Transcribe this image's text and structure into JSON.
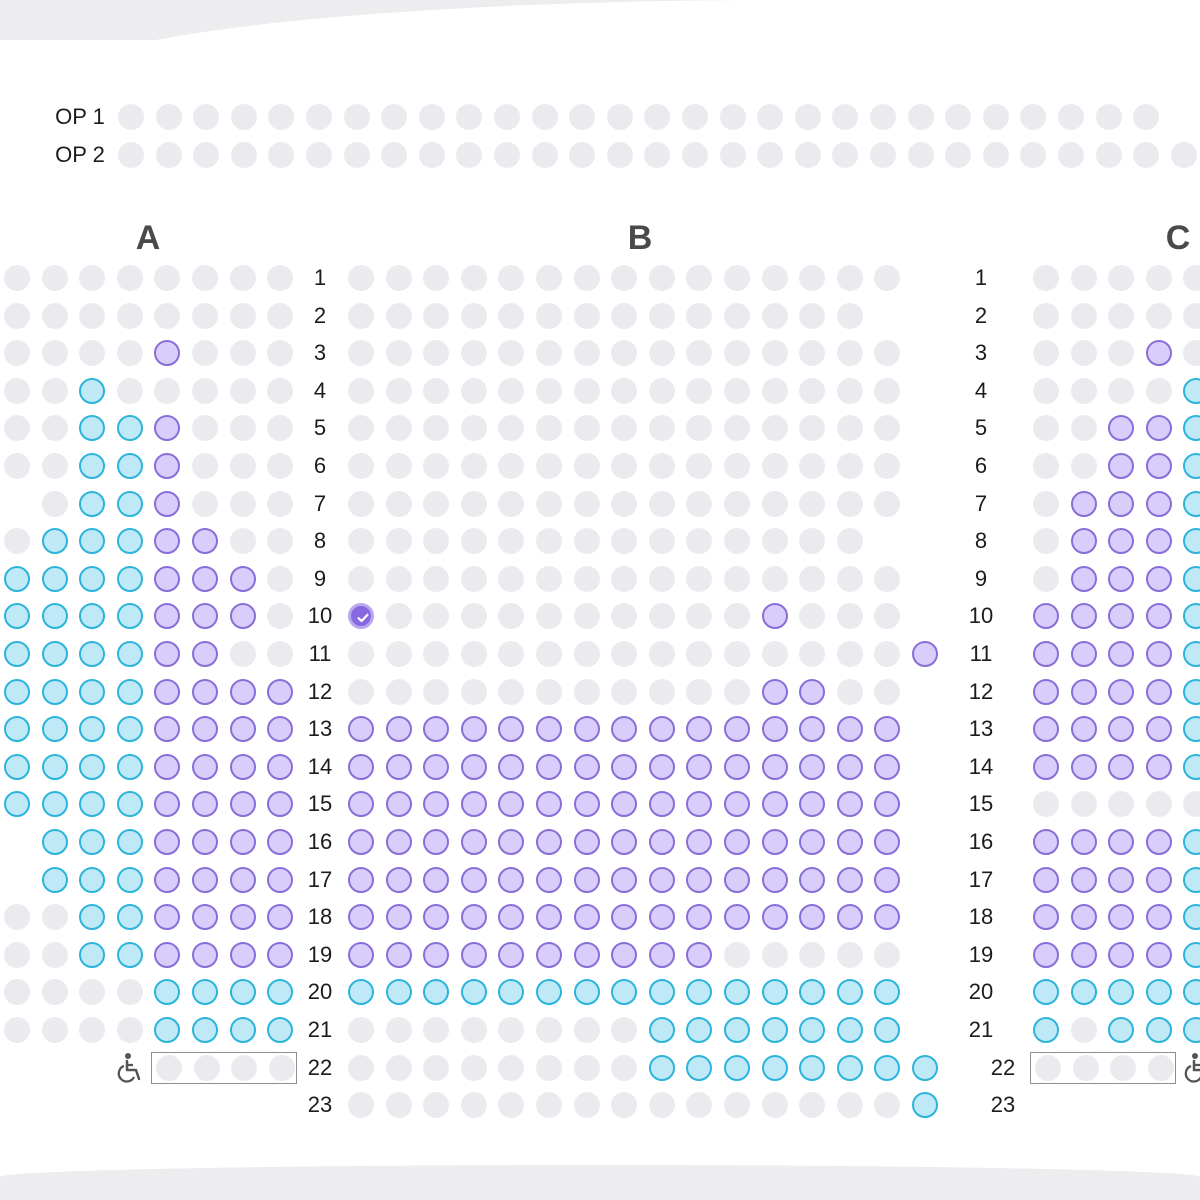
{
  "sections": {
    "a": "A",
    "b": "B",
    "c": "C"
  },
  "op_rows": [
    "OP 1",
    "OP 2"
  ],
  "rows_a": [
    "1",
    "2",
    "3",
    "4",
    "5",
    "6",
    "7",
    "8",
    "9",
    "10",
    "11",
    "12",
    "13",
    "14",
    "15",
    "16",
    "17",
    "18",
    "19",
    "20",
    "21",
    "22",
    "23"
  ],
  "rows_b_right": [
    "1",
    "2",
    "3",
    "4",
    "5",
    "6",
    "7",
    "8",
    "9",
    "10",
    "11",
    "12",
    "13",
    "14",
    "15",
    "16",
    "17",
    "18",
    "19",
    "20",
    "21",
    "22",
    "23"
  ],
  "legend": {
    "unavailable": "unavailable-seat",
    "blue": "blue-category-seat",
    "purple": "purple-category-seat",
    "selected": "selected-seat"
  },
  "colors": {
    "unavailable": "#ebebef",
    "blue_fill": "#bfe9f7",
    "blue_border": "#2cb4db",
    "purple_fill": "#d9cdfb",
    "purple_border": "#8a6ed8",
    "selected": "#8668e0"
  },
  "icons": {
    "wheelchair": "wheelchair-icon",
    "check": "check-icon"
  },
  "seatmap": {
    "A": [
      "uuuuuuuu",
      "uuuuuuuu",
      "uuuupuuu",
      "uubuuuuu",
      "uubbpuuu",
      "uubbpuuu",
      "-ubbpuuu",
      "ubbbppuu",
      "bbbbpppu",
      "bbbbpppu",
      "bbbbppuu",
      "bbbbpppp",
      "bbbbpppp",
      "bbbbpppp",
      "bbbbpppp",
      "-bbbpppp",
      "-bbbpppp",
      "uubbpppp",
      "uubbpppp",
      "uuuubbbb",
      "uuuubbbb",
      "----wwww",
      "--------"
    ],
    "B": [
      "uuuuuuuuuuuuuuu",
      "uuuuuuuuuuuuuu-",
      "uuuuuuuuuuuuuuu",
      "uuuuuuuuuuuuuuu",
      "uuuuuuuuuuuuuuu",
      "uuuuuuuuuuuuuuu",
      "uuuuuuuuuuuuuuu",
      "uuuuuuuuuuuuuu-",
      "uuuuuuuuuuuuuuu",
      "suuuuuuuuuupuuu",
      "uuuuuuuuuuuuuuup",
      "uuuuuuuuuuuppuu",
      "ppppppppppppppp",
      "ppppppppppppppp",
      "ppppppppppppppp",
      "ppppppppppppppp",
      "ppppppppppppppp",
      "ppppppppppppppp",
      "ppppppppppuuuuu",
      "bbbbbbbbbbbbbbb",
      "uuuuuuuubbbbbbb",
      "uuuuuuuubbbbbbbb",
      "uuuuuuuuuuuuuuub"
    ],
    "C": [
      "uuuuu",
      "uuuuu",
      "uuupu",
      "uuuub",
      "uuppb",
      "uuppb",
      "upppb",
      "upppb",
      "upppb",
      "ppppb",
      "ppppb",
      "ppppb",
      "ppppb",
      "ppppb",
      "uuuuu",
      "ppppb",
      "ppppb",
      "ppppb",
      "ppppb",
      "bbbbb",
      "bubbb",
      "wwww-",
      "-----"
    ]
  }
}
